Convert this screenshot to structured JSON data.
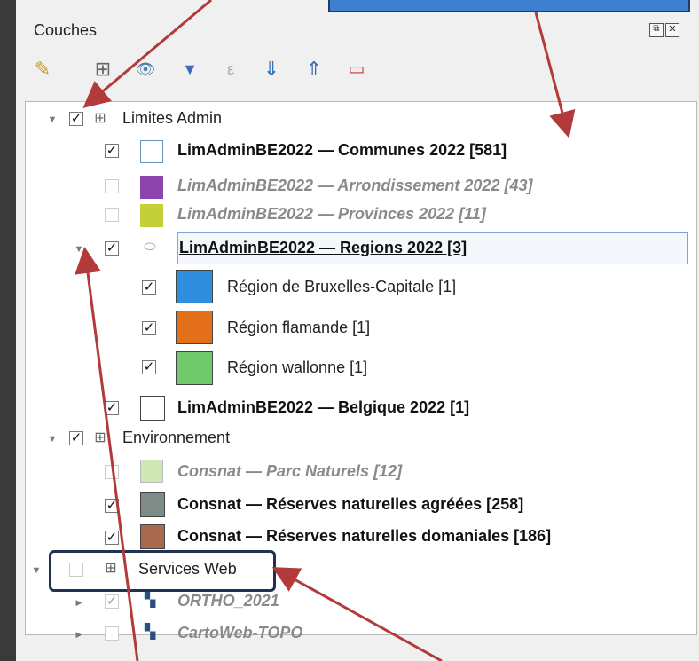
{
  "panel": {
    "title": "Couches",
    "dock_float_glyph": "⧉",
    "dock_close_glyph": "✕"
  },
  "toolbar": [
    {
      "icon": "style-brush-icon",
      "glyph": "✎"
    },
    {
      "icon": "add-group-icon",
      "glyph": "⊞"
    },
    {
      "icon": "visibility-eye-icon",
      "glyph": "👁"
    },
    {
      "icon": "filter-icon",
      "glyph": "▼"
    },
    {
      "icon": "expression-filter-icon",
      "glyph": "ε"
    },
    {
      "icon": "expand-all-icon",
      "glyph": "⇓"
    },
    {
      "icon": "collapse-all-icon",
      "glyph": "⇑"
    },
    {
      "icon": "remove-layer-icon",
      "glyph": "▭"
    }
  ],
  "tree": {
    "groups": [
      {
        "label": "Limites Admin",
        "checked": true
      },
      {
        "label": "Environnement",
        "checked": true
      },
      {
        "label": "Services Web",
        "checked": false
      }
    ],
    "layers": {
      "communes": {
        "label": "LimAdminBE2022 — Communes 2022 [581]",
        "checked": true,
        "color": "#ffffff"
      },
      "arrondissement": {
        "label": "LimAdminBE2022 — Arrondissement 2022 [43]",
        "checked": false,
        "color": "#8e44ad"
      },
      "provinces": {
        "label": "LimAdminBE2022 — Provinces 2022 [11]",
        "checked": false,
        "color": "#c4d03a"
      },
      "regions": {
        "label": "LimAdminBE2022 — Regions 2022 [3]",
        "checked": true
      },
      "belgique": {
        "label": "LimAdminBE2022 — Belgique 2022 [1]",
        "checked": true,
        "color": "#ffffff"
      },
      "parcs": {
        "label": "Consnat — Parc Naturels [12]",
        "checked": false,
        "color": "#cfe6b5"
      },
      "reserves_agreees": {
        "label": "Consnat — Réserves naturelles agréées [258]",
        "checked": true,
        "color": "#7f8b87"
      },
      "reserves_domaniales": {
        "label": "Consnat — Réserves naturelles domaniales [186]",
        "checked": true,
        "color": "#a86a4f"
      },
      "ortho": {
        "label": "ORTHO_2021",
        "checked": true
      },
      "cartoweb": {
        "label": "CartoWeb-TOPO",
        "checked": false
      }
    },
    "categories": [
      {
        "label": "Région de Bruxelles-Capitale [1]",
        "checked": true,
        "color": "#2f8fde"
      },
      {
        "label": "Région flamande [1]",
        "checked": true,
        "color": "#e46f1a"
      },
      {
        "label": "Région wallonne [1]",
        "checked": true,
        "color": "#70c96a"
      }
    ]
  },
  "annotation": {
    "arrow_color": "#b33a3a",
    "highlight_color": "#1f3251"
  }
}
